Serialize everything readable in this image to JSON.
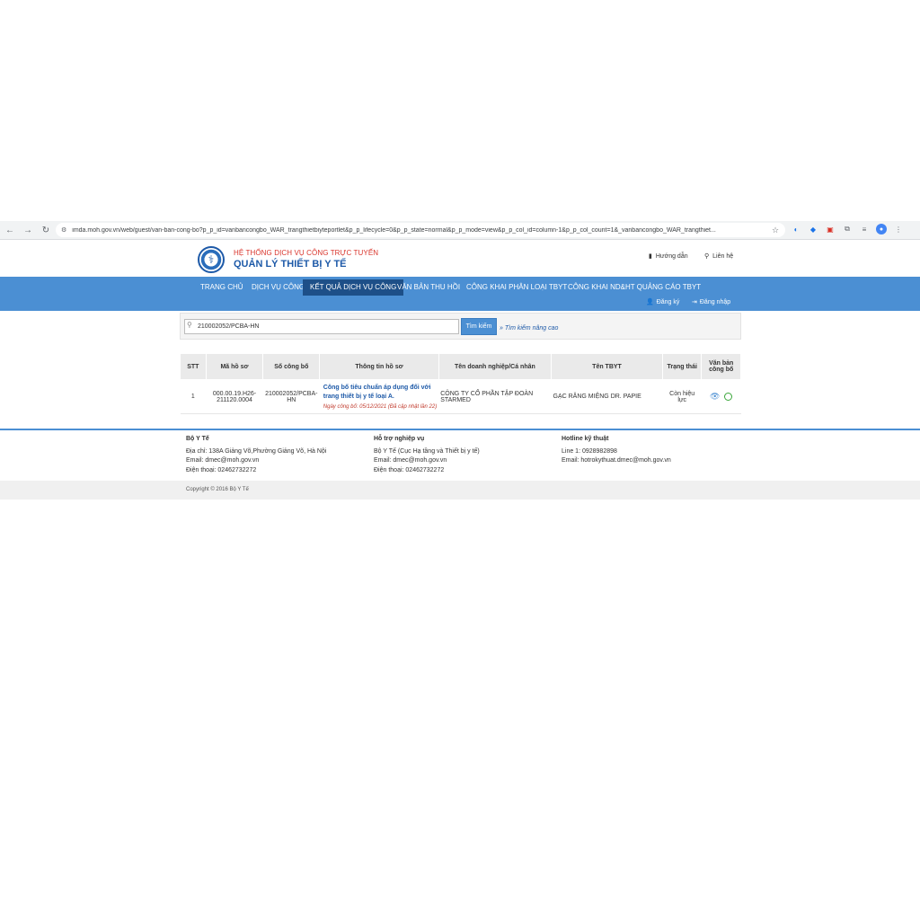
{
  "browser": {
    "url": "imda.moh.gov.vn/web/guest/van-ban-cong-bo?p_p_id=vanbancongbo_WAR_trangthietbiyteportlet&p_p_lifecycle=0&p_p_state=normal&p_p_mode=view&p_p_col_id=column-1&p_p_col_count=1&_vanbancongbo_WAR_trangthiet..."
  },
  "header": {
    "title_top": "HỆ THỐNG DỊCH VỤ CÔNG TRỰC TUYẾN",
    "title_main": "QUẢN LÝ THIẾT BỊ Y TẾ",
    "help": "Hướng dẫn",
    "contact": "Liên hệ"
  },
  "nav": {
    "items": [
      "TRANG CHỦ",
      "DỊCH VỤ CÔNG",
      "KẾT QUẢ DỊCH VỤ CÔNG",
      "VĂN BẢN THU HỒI",
      "CÔNG KHAI PHÂN LOẠI TBYT",
      "CÔNG KHAI ND&HT QUẢNG CÁO TBYT"
    ],
    "register": "Đăng ký",
    "login": "Đăng nhập"
  },
  "search": {
    "value": "210002052/PCBA-HN",
    "button": "Tìm kiếm",
    "advanced": "Tìm kiếm nâng cao"
  },
  "table": {
    "headers": [
      "STT",
      "Mã hồ sơ",
      "Số công bố",
      "Thông tin hồ sơ",
      "Tên doanh nghiệp/Cá nhân",
      "Tên TBYT",
      "Trạng thái",
      "Văn bản công bố"
    ],
    "rows": [
      {
        "stt": "1",
        "ma_ho_so": "000.00.19.H26-211120.0004",
        "so_cong_bo": "210002052/PCBA-HN",
        "info_title": "Công bố tiêu chuẩn áp dụng đối với trang thiết bị y tế loại A.",
        "info_date": "Ngày công bố: 05/12/2021   (Đã cập nhật lần 22)",
        "doanh_nghiep": "CÔNG TY CỔ PHẦN TẬP ĐOÀN STARMED",
        "ten_tbyt": "GẠC RĂNG MIỆNG DR. PAPIE",
        "trang_thai": "Còn hiệu lực"
      }
    ]
  },
  "footer": {
    "col1": {
      "head": "Bộ Y Tế",
      "lines": [
        "Địa chỉ: 138A Giảng Võ,Phường Giảng Võ, Hà Nội",
        "Email: dmec@moh.gov.vn",
        "Điện thoại: 02462732272"
      ]
    },
    "col2": {
      "head": "Hỗ trợ nghiệp vụ",
      "lines": [
        "Bộ Y Tế (Cục Hạ tầng và Thiết bị y tế)",
        "Email: dmec@moh.gov.vn",
        "Điện thoại: 02462732272"
      ]
    },
    "col3": {
      "head": "Hotline kỹ thuật",
      "lines": [
        "Line 1: 0928982898",
        "Email: hotrokythuat.dmec@moh.gov.vn"
      ]
    },
    "copyright": "Copyright © 2016 Bộ Y Tế"
  },
  "colors": {
    "nav_blue": "#4b8fd3",
    "nav_active": "#1d4f88",
    "title_red": "#d9342b",
    "title_blue": "#1e5aa8"
  }
}
